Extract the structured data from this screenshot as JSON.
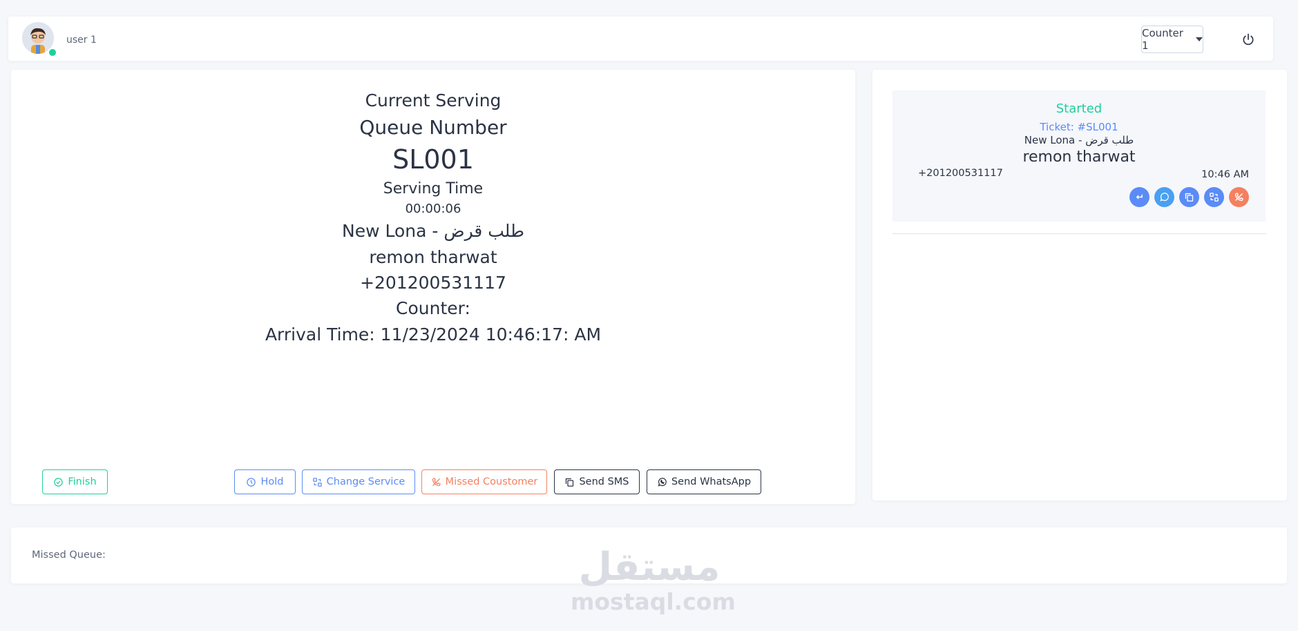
{
  "header": {
    "user_name": "user 1",
    "counter_selected": "Counter 1",
    "avatar_icon": "user-avatar",
    "power_icon": "power-icon"
  },
  "serving": {
    "title": "Current Serving",
    "queue_label": "Queue Number",
    "queue_number": "SL001",
    "serving_time_label": "Serving Time",
    "serving_time": "00:00:06",
    "service": "New Lona - طلب قرض",
    "customer_name": "remon tharwat",
    "phone": "+201200531117",
    "counter_label": "Counter:",
    "arrival": "Arrival Time: 11/23/2024 10:46:17: AM"
  },
  "actions": {
    "finish": "Finish",
    "hold": "Hold",
    "change_service": "Change Service",
    "missed": "Missed Coustomer",
    "send_sms": "Send SMS",
    "send_whatsapp": "Send WhatsApp"
  },
  "queue": {
    "items": [
      {
        "status": "Started",
        "ticket": "Ticket: #SL001",
        "service": "New Lona - طلب قرض",
        "name": "remon tharwat",
        "phone": "+201200531117",
        "time": "10:46 AM"
      }
    ]
  },
  "missed": {
    "label": "Missed Queue:"
  },
  "watermark": {
    "arabic": "مستقل",
    "latin": "mostaql.com"
  },
  "colors": {
    "green": "#1fcf9a",
    "blue": "#5b8bf7",
    "orange": "#f5805f",
    "text": "#2b3444"
  }
}
